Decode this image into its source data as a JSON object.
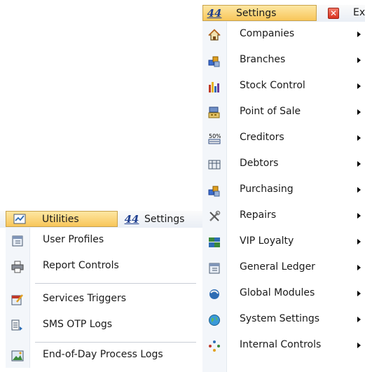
{
  "settings_menu": {
    "header_logo": "44",
    "header_label": "Settings",
    "exit_label": "Ex",
    "items": [
      {
        "label": "Companies",
        "icon": "house-icon"
      },
      {
        "label": "Branches",
        "icon": "cubes-icon"
      },
      {
        "label": "Stock Control",
        "icon": "bar-chart-icon"
      },
      {
        "label": "Point of Sale",
        "icon": "register-icon"
      },
      {
        "label": "Creditors",
        "icon": "percent-tag-icon"
      },
      {
        "label": "Debtors",
        "icon": "ledger-icon"
      },
      {
        "label": "Purchasing",
        "icon": "cubes-icon"
      },
      {
        "label": "Repairs",
        "icon": "tools-icon"
      },
      {
        "label": "VIP Loyalty",
        "icon": "loyalty-icon"
      },
      {
        "label": "General Ledger",
        "icon": "calendar-book-icon"
      },
      {
        "label": "Global Modules",
        "icon": "globe-swirl-icon"
      },
      {
        "label": "System Settings",
        "icon": "globe-icon"
      },
      {
        "label": "Internal Controls",
        "icon": "cycle-icon"
      }
    ]
  },
  "utilities_menu": {
    "header_label": "Utilities",
    "header_icon": "chart-check-icon",
    "settings_tab_logo": "44",
    "settings_tab_label": "Settings",
    "items": [
      {
        "label": "User Profiles",
        "icon": "calendar-book-icon"
      },
      {
        "label": "Report Controls",
        "icon": "printer-icon"
      },
      {
        "label": "Services Triggers",
        "icon": "calendar-pencil-icon"
      },
      {
        "label": "SMS OTP Logs",
        "icon": "list-arrow-icon"
      },
      {
        "label": "End-of-Day Process Logs",
        "icon": "image-icon"
      }
    ]
  },
  "colors": {
    "highlight": "#f8c65a",
    "logo_blue": "#1f3f8f",
    "exit_red": "#d9321f"
  }
}
